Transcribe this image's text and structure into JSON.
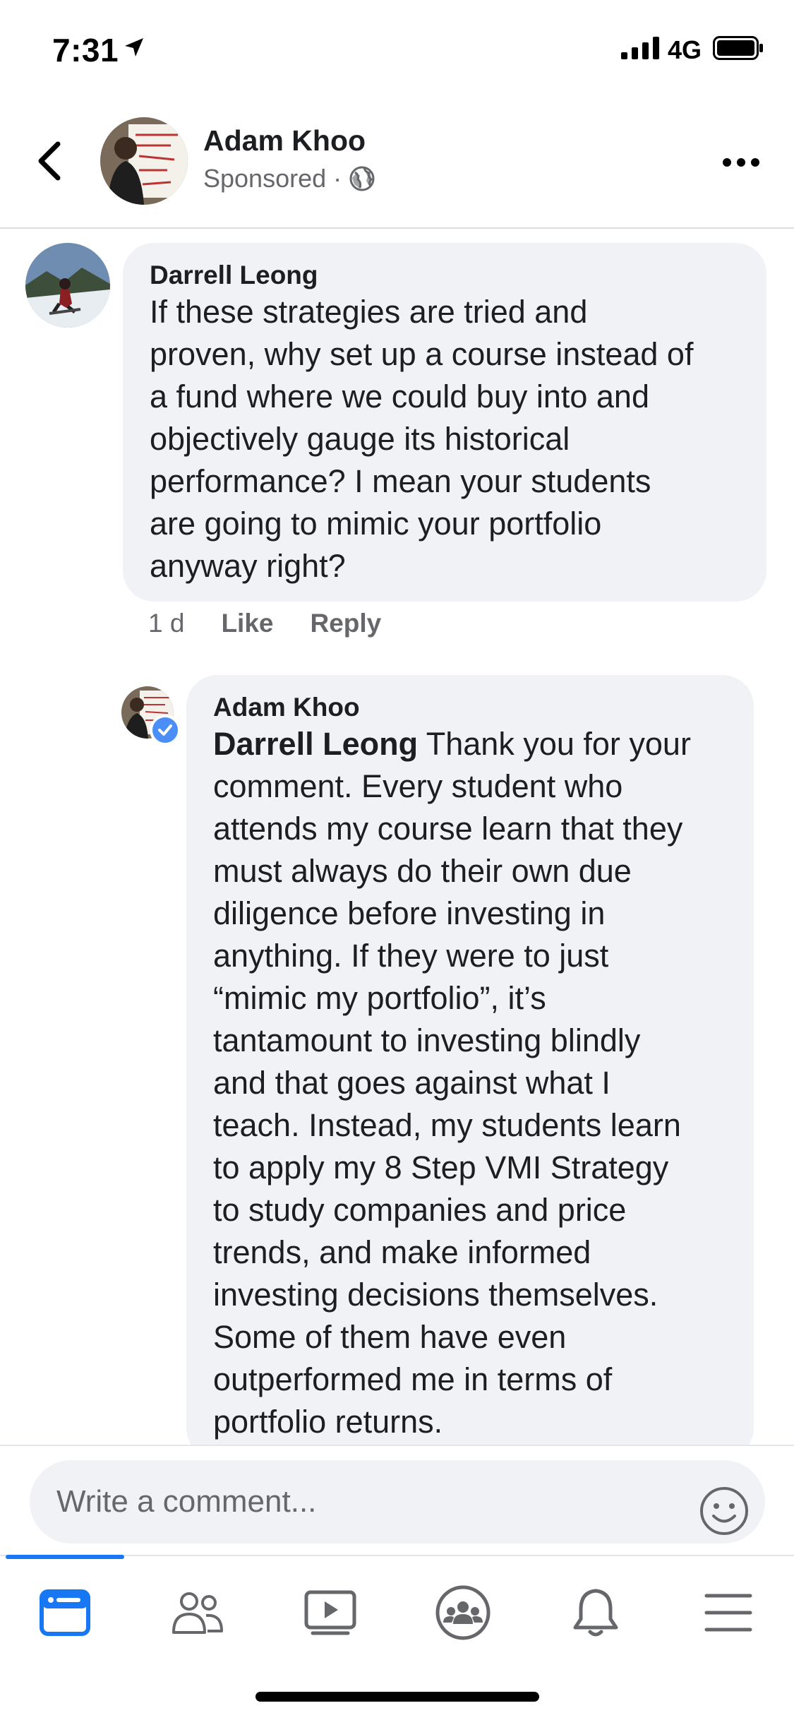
{
  "status_bar": {
    "time": "7:31",
    "network": "4G"
  },
  "header": {
    "page_name": "Adam Khoo",
    "sponsored_label": "Sponsored",
    "separator": "·"
  },
  "comments": [
    {
      "author": "Darrell Leong",
      "lines": [
        "If these strategies are tried and",
        "proven, why set up a course instead of",
        "a fund where we could buy into and",
        "objectively gauge its historical",
        "performance? I mean your students",
        "are going to mimic your portfolio",
        "anyway right?"
      ],
      "time": "1 d",
      "like_label": "Like",
      "reply_label": "Reply"
    },
    {
      "author": "Adam Khoo",
      "verified": true,
      "mention": "Darrell Leong",
      "first_line_rest": " Thank you for your",
      "lines": [
        "comment. Every student who",
        "attends my course learn that they",
        "must always do their own due",
        "diligence before investing in",
        "anything. If they were to just",
        "“mimic my portfolio”, it’s",
        "tantamount to investing blindly",
        "and that goes against what I",
        "teach. Instead, my students learn",
        "to apply my 8 Step VMI Strategy",
        "to study companies and price",
        "trends, and make informed",
        "investing decisions themselves.",
        "Some of them have even",
        "outperformed me in terms of",
        "portfolio returns."
      ]
    }
  ],
  "composer": {
    "placeholder": "Write a comment..."
  },
  "tabs": [
    {
      "icon": "news-feed-icon",
      "active": true
    },
    {
      "icon": "friends-icon",
      "active": false
    },
    {
      "icon": "watch-icon",
      "active": false
    },
    {
      "icon": "groups-icon",
      "active": false
    },
    {
      "icon": "notifications-icon",
      "active": false
    },
    {
      "icon": "menu-icon",
      "active": false
    }
  ],
  "colors": {
    "accent": "#1877f2",
    "bubble": "#f0f2f5",
    "secondary_text": "#65676b",
    "verified": "#4c8ef7"
  }
}
